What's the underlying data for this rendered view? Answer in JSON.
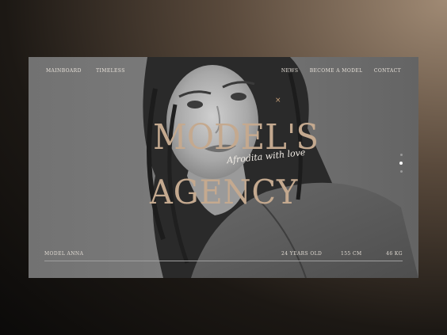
{
  "nav": {
    "left": [
      "MAINBOARD",
      "TIMELESS"
    ],
    "right": [
      "NEWS",
      "BECOME A MODEL",
      "CONTACT"
    ]
  },
  "hero": {
    "title_line1": "MODEL'S",
    "script": "Afrodita with love",
    "title_line2": "AGENCY",
    "close_icon": "×"
  },
  "slider": {
    "count": 3,
    "active_index": 1
  },
  "model": {
    "name": "MODEL ANNA",
    "age": "24 YEARS OLD",
    "height": "155 CM",
    "weight": "46 KG"
  },
  "colors": {
    "accent": "#c4a98f",
    "close": "#c9a17a",
    "nav_text": "#e8e2da"
  }
}
